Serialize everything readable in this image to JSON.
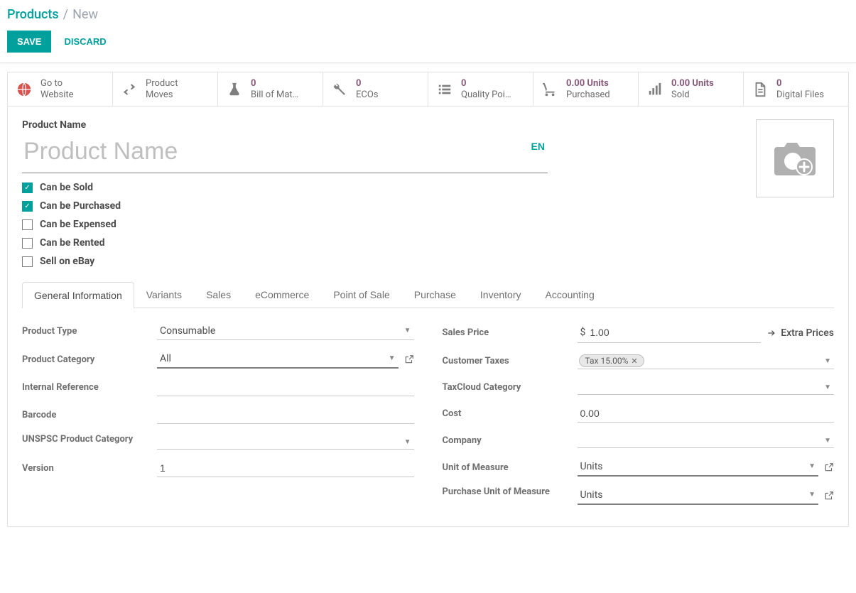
{
  "breadcrumb": {
    "parent": "Products",
    "current": "New"
  },
  "actions": {
    "save": "SAVE",
    "discard": "DISCARD"
  },
  "statButtons": [
    {
      "id": "go-to-website",
      "line1": "Go to",
      "line2": "Website",
      "icon": "globe"
    },
    {
      "id": "product-moves",
      "line1": "Product",
      "line2": "Moves",
      "icon": "arrows"
    },
    {
      "id": "bom",
      "value": "0",
      "label": "Bill of Mat…",
      "icon": "flask"
    },
    {
      "id": "ecos",
      "value": "0",
      "label": "ECOs",
      "icon": "wrench"
    },
    {
      "id": "quality",
      "value": "0",
      "label": "Quality Poi…",
      "icon": "list"
    },
    {
      "id": "purchased",
      "value": "0.00 Units",
      "label": "Purchased",
      "icon": "cart"
    },
    {
      "id": "sold",
      "value": "0.00 Units",
      "label": "Sold",
      "icon": "bars"
    },
    {
      "id": "digital",
      "value": "0",
      "label": "Digital Files",
      "icon": "file"
    }
  ],
  "product": {
    "nameLabel": "Product Name",
    "namePlaceholder": "Product Name",
    "langButton": "EN",
    "checkboxes": [
      {
        "id": "can-be-sold",
        "label": "Can be Sold",
        "checked": true
      },
      {
        "id": "can-be-purchased",
        "label": "Can be Purchased",
        "checked": true
      },
      {
        "id": "can-be-expensed",
        "label": "Can be Expensed",
        "checked": false
      },
      {
        "id": "can-be-rented",
        "label": "Can be Rented",
        "checked": false
      },
      {
        "id": "sell-on-ebay",
        "label": "Sell on eBay",
        "checked": false
      }
    ]
  },
  "tabs": [
    "General Information",
    "Variants",
    "Sales",
    "eCommerce",
    "Point of Sale",
    "Purchase",
    "Inventory",
    "Accounting"
  ],
  "activeTab": 0,
  "general": {
    "left": {
      "productType": {
        "label": "Product Type",
        "value": "Consumable"
      },
      "productCategory": {
        "label": "Product Category",
        "value": "All"
      },
      "internalRef": {
        "label": "Internal Reference",
        "value": ""
      },
      "barcode": {
        "label": "Barcode",
        "value": ""
      },
      "unspsc": {
        "label": "UNSPSC Product Category",
        "value": ""
      },
      "version": {
        "label": "Version",
        "value": "1"
      }
    },
    "right": {
      "salesPrice": {
        "label": "Sales Price",
        "currency": "$",
        "value": "1.00",
        "extraPrices": "Extra Prices"
      },
      "customerTaxes": {
        "label": "Customer Taxes",
        "tag": "Tax 15.00%"
      },
      "taxcloud": {
        "label": "TaxCloud Category",
        "value": ""
      },
      "cost": {
        "label": "Cost",
        "value": "0.00"
      },
      "company": {
        "label": "Company",
        "value": ""
      },
      "uom": {
        "label": "Unit of Measure",
        "value": "Units"
      },
      "puom": {
        "label": "Purchase Unit of Measure",
        "value": "Units"
      }
    }
  }
}
